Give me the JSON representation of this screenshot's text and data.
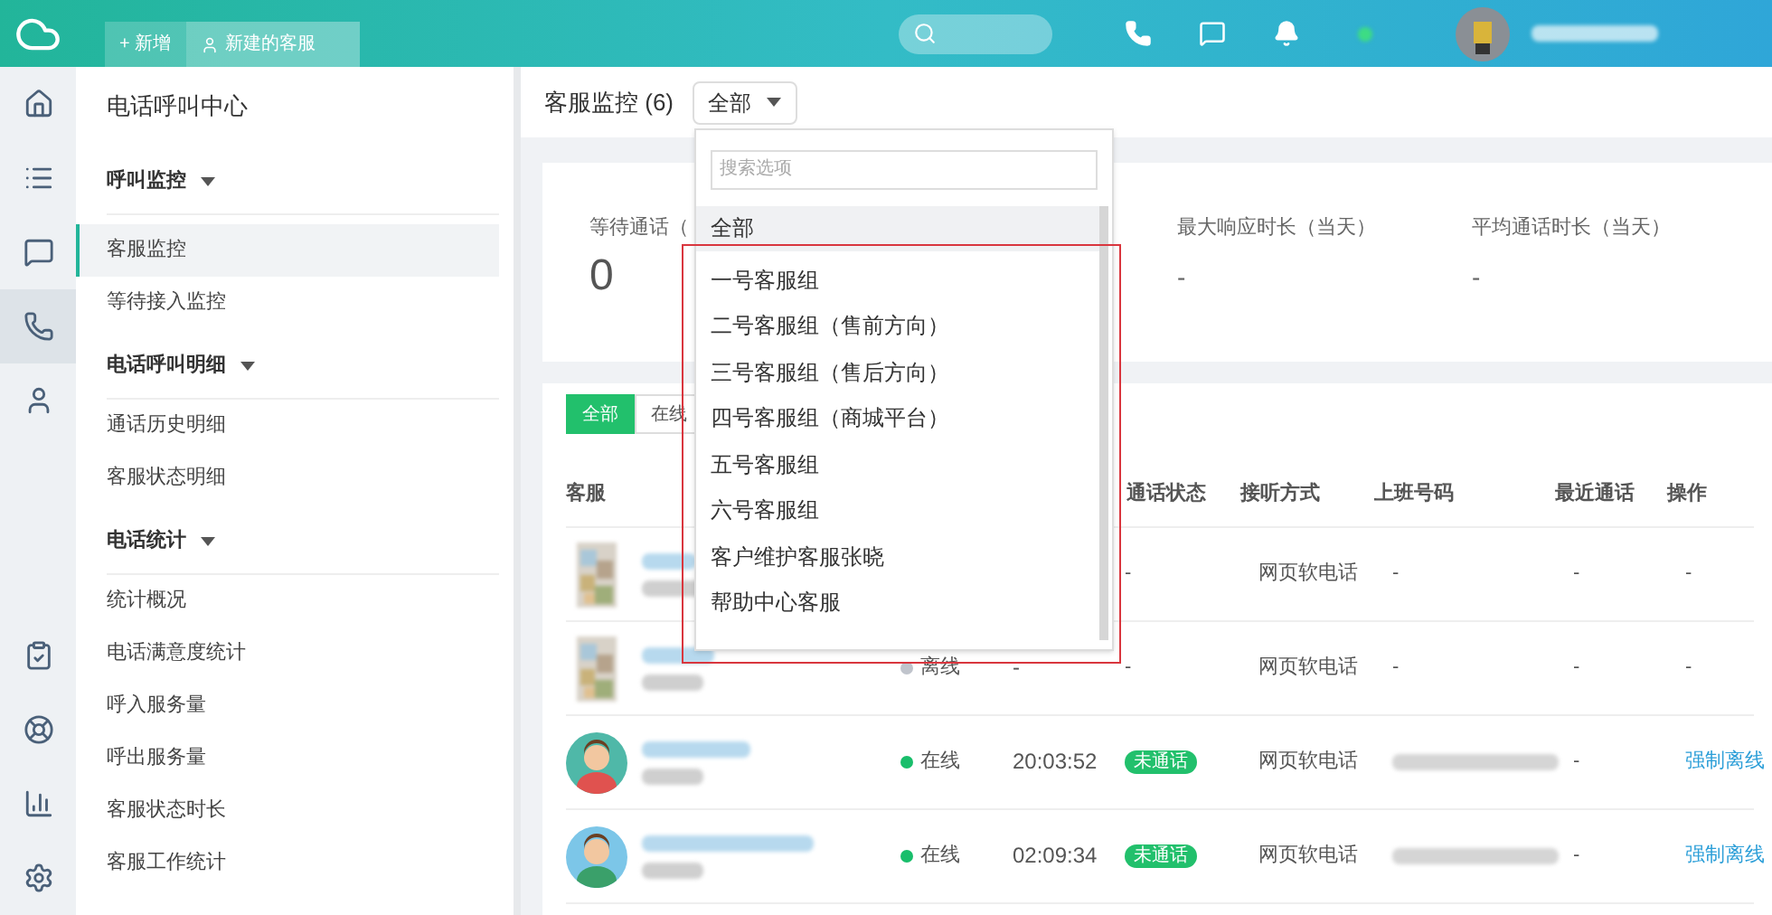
{
  "topbar": {
    "new_button": "+ 新增",
    "tabs": [
      {
        "label": "新建的客服",
        "selected": true
      }
    ]
  },
  "nav_rail": [
    {
      "kind": "home",
      "selected": false
    },
    {
      "kind": "list",
      "selected": false
    },
    {
      "kind": "chat",
      "selected": false
    },
    {
      "kind": "phone",
      "selected": true
    },
    {
      "kind": "user",
      "selected": false
    },
    {
      "kind": "tasks",
      "selected": false
    },
    {
      "kind": "help",
      "selected": false
    },
    {
      "kind": "chart",
      "selected": false
    },
    {
      "kind": "settings",
      "selected": false
    }
  ],
  "sidebar": {
    "title": "电话呼叫中心",
    "sections": [
      {
        "title": "呼叫监控",
        "expanded": true,
        "items": [
          {
            "label": "客服监控",
            "selected": true
          },
          {
            "label": "等待接入监控",
            "selected": false
          }
        ]
      },
      {
        "title": "电话呼叫明细",
        "expanded": true,
        "items": [
          {
            "label": "通话历史明细",
            "selected": false
          },
          {
            "label": "客服状态明细",
            "selected": false
          }
        ]
      },
      {
        "title": "电话统计",
        "expanded": true,
        "items": [
          {
            "label": "统计概况",
            "selected": false
          },
          {
            "label": "电话满意度统计",
            "selected": false
          },
          {
            "label": "呼入服务量",
            "selected": false
          },
          {
            "label": "呼出服务量",
            "selected": false
          },
          {
            "label": "客服状态时长",
            "selected": false
          },
          {
            "label": "客服工作统计",
            "selected": false
          }
        ]
      }
    ]
  },
  "main": {
    "title": "客服监控 (6)",
    "group_select": {
      "value": "全部",
      "expanded": true
    },
    "stats": [
      {
        "label": "等待通话（",
        "value": "0"
      },
      {
        "label": "最大响应时长（当天）",
        "value": "-"
      },
      {
        "label": "平均通话时长（当天）",
        "value": "-"
      }
    ],
    "filters": [
      {
        "label": "全部",
        "selected": true
      },
      {
        "label": "在线",
        "selected": false
      }
    ],
    "table": {
      "columns": [
        "客服",
        "通话状态",
        "接听方式",
        "上班号码",
        "最近通话",
        "操作"
      ],
      "rows": [
        {
          "kind": "blur",
          "status": null,
          "color": null,
          "duration": null,
          "call_status": "-",
          "call_badge": false,
          "method": "网页软电话",
          "number": "-",
          "recent": "-",
          "action": "-",
          "action_link": false
        },
        {
          "kind": "blur",
          "status": "离线",
          "color": "#c0c4cc",
          "duration": "-",
          "call_status": "-",
          "call_badge": false,
          "method": "网页软电话",
          "number": "-",
          "recent": "-",
          "action": "-",
          "action_link": false
        },
        {
          "kind": "girl",
          "status": "在线",
          "color": "#19be6b",
          "duration": "20:03:52",
          "call_status": "未通话",
          "call_badge": true,
          "method": "网页软电话",
          "number": null,
          "recent": "-",
          "action": "强制离线",
          "action_link": true
        },
        {
          "kind": "boy",
          "status": "在线",
          "color": "#19be6b",
          "duration": "02:09:34",
          "call_status": "未通话",
          "call_badge": true,
          "method": "网页软电话",
          "number": null,
          "recent": "-",
          "action": "强制离线",
          "action_link": true
        }
      ]
    }
  },
  "dropdown": {
    "placeholder": "搜索选项",
    "options": [
      {
        "label": "全部",
        "selected": true
      },
      {
        "label": "一号客服组",
        "selected": false
      },
      {
        "label": "二号客服组（售前方向）",
        "selected": false
      },
      {
        "label": "三号客服组（售后方向）",
        "selected": false
      },
      {
        "label": "四号客服组（商城平台）",
        "selected": false
      },
      {
        "label": "五号客服组",
        "selected": false
      },
      {
        "label": "六号客服组",
        "selected": false
      },
      {
        "label": "客户维护客服张晓",
        "selected": false
      },
      {
        "label": "帮助中心客服",
        "selected": false
      }
    ]
  }
}
